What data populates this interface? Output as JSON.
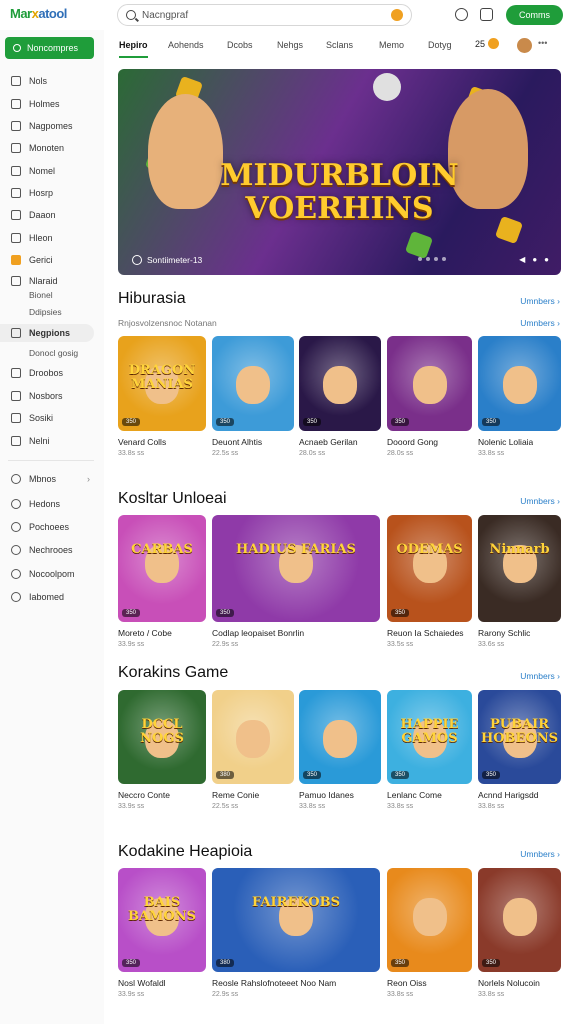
{
  "header": {
    "logo": {
      "a": "Mar",
      "b": "x",
      "c": "atool"
    },
    "search_placeholder": "Nacngpraf",
    "signin_label": "Comms",
    "coin_count": "25"
  },
  "sidebar": {
    "primary_button": "Noncompres",
    "items": [
      {
        "label": "Nols",
        "icon": "cube-icon"
      },
      {
        "label": "Holmes",
        "icon": "grid-icon"
      },
      {
        "label": "Nagpomes",
        "icon": "list-icon"
      },
      {
        "label": "Monoten",
        "icon": "doc-icon"
      },
      {
        "label": "Nomel",
        "icon": "calendar-icon"
      },
      {
        "label": "Hosrp",
        "icon": "box-icon"
      },
      {
        "label": "Daaon",
        "icon": "chart-icon"
      },
      {
        "label": "Hleon",
        "icon": "home-icon"
      },
      {
        "label": "Gerici",
        "icon": "star-icon"
      },
      {
        "label": "Nlaraid",
        "icon": "doc-icon"
      },
      {
        "label": "Bionel",
        "sub": true
      },
      {
        "label": "Ddipsies",
        "sub": true
      },
      {
        "label": "Negpions",
        "icon": "flag-icon",
        "active": true
      },
      {
        "label": "Donocl gosig",
        "sub": true
      },
      {
        "label": "Droobos",
        "icon": "refresh-icon"
      },
      {
        "label": "Nosbors",
        "icon": "grid-icon"
      },
      {
        "label": "Sosiki",
        "icon": "chat-icon"
      },
      {
        "label": "Nelni",
        "icon": "settings-icon"
      }
    ],
    "secondary": [
      {
        "label": "Mbnos",
        "icon": "globe-icon"
      },
      {
        "label": "Hedons",
        "icon": "info-icon"
      },
      {
        "label": "Pochoees",
        "icon": "pen-icon"
      },
      {
        "label": "Nechrooes",
        "icon": "gear-icon"
      },
      {
        "label": "Nocoolpom",
        "icon": "mail-icon"
      },
      {
        "label": "Iabomed",
        "icon": "bookmark-icon"
      }
    ]
  },
  "tabs": [
    "Hepiro",
    "Aohends",
    "Dcobs",
    "Nehgs",
    "Sclans",
    "Memo",
    "Dotyg"
  ],
  "hero": {
    "title_line1": "MIDURBLOIN",
    "title_line2": "VOERHINS",
    "caption": "Sontiimeter-13"
  },
  "sections": [
    {
      "title": "Hiburasia",
      "link": "Umnbers",
      "subtitle": "Rnjosvolzensnoc Notanan",
      "sublink": "Umnbers",
      "cards": [
        {
          "label": "Venard Colls",
          "meta": "33.8s ss",
          "badge": "350",
          "art": "DRAGON MANIAS",
          "bg": "#e8a21c"
        },
        {
          "label": "Deuont Alhtis",
          "meta": "22.5s ss",
          "badge": "350",
          "art": "",
          "bg": "#3d9bd8"
        },
        {
          "label": "Acnaeb Gerilan",
          "meta": "28.0s ss",
          "badge": "350",
          "art": "",
          "bg": "#2a1848"
        },
        {
          "label": "Dooord Gong",
          "meta": "28.0s ss",
          "badge": "350",
          "art": "",
          "bg": "#7a2f8a"
        },
        {
          "label": "Nolenic Loliaia",
          "meta": "33.8s ss",
          "badge": "350",
          "art": "",
          "bg": "#2a7fc9"
        }
      ]
    },
    {
      "title": "Kosltar Unloeai",
      "link": "Umnbers",
      "cards": [
        {
          "label": "Moreto / Cobe",
          "meta": "33.9s ss",
          "badge": "350",
          "art": "CARBAS",
          "bg": "#c84fb8"
        },
        {
          "label": "Codlap leopaiset Bonrlin",
          "meta": "22.9s ss",
          "badge": "350",
          "art": "HADIUS FARIAS",
          "bg": "#8f3aa8"
        },
        {
          "label": "Reuon Ia Schaiedes",
          "meta": "33.5s ss",
          "badge": "350",
          "art": "ODEMAS",
          "bg": "#b8521c"
        },
        {
          "label": "Rarony Schlic",
          "meta": "33.6s ss",
          "badge": "",
          "art": "Ninnarb",
          "bg": "#3a2b24"
        }
      ]
    },
    {
      "title": "Korakins Game",
      "link": "Umnbers",
      "cards": [
        {
          "label": "Neccro Conte",
          "meta": "33.9s ss",
          "badge": "",
          "art": "DCCL NOGS",
          "bg": "#2f6a30"
        },
        {
          "label": "Reme Conie",
          "meta": "22.5s ss",
          "badge": "380",
          "art": "",
          "bg": "#f1d08a"
        },
        {
          "label": "Pamuo Idanes",
          "meta": "33.8s ss",
          "badge": "350",
          "art": "",
          "bg": "#2a9ad8"
        },
        {
          "label": "Lenlanc Come",
          "meta": "33.8s ss",
          "badge": "350",
          "art": "HAPPIE GAMOS",
          "bg": "#3db0e0"
        },
        {
          "label": "Acnnd Harigsdd",
          "meta": "33.8s ss",
          "badge": "350",
          "art": "PUBAIR HOBEONS",
          "bg": "#2a4a9a"
        }
      ]
    },
    {
      "title": "Kodakine Heapioia",
      "link": "Umnbers",
      "cards": [
        {
          "label": "Nosl Wofaldl",
          "meta": "33.9s ss",
          "badge": "350",
          "art": "BAIS BAMONS",
          "bg": "#b84fc8"
        },
        {
          "label": "Reosle Rahslofnoteeet Noo Nam",
          "meta": "22.9s ss",
          "badge": "380",
          "art": "FAIREKOBS",
          "bg": "#2a5fb8"
        },
        {
          "label": "Reon Oiss",
          "meta": "33.8s ss",
          "badge": "350",
          "art": "",
          "bg": "#e88a1c"
        },
        {
          "label": "Norlels Nolucoin",
          "meta": "33.8s ss",
          "badge": "350",
          "art": "",
          "bg": "#8a3a2a"
        }
      ]
    }
  ]
}
